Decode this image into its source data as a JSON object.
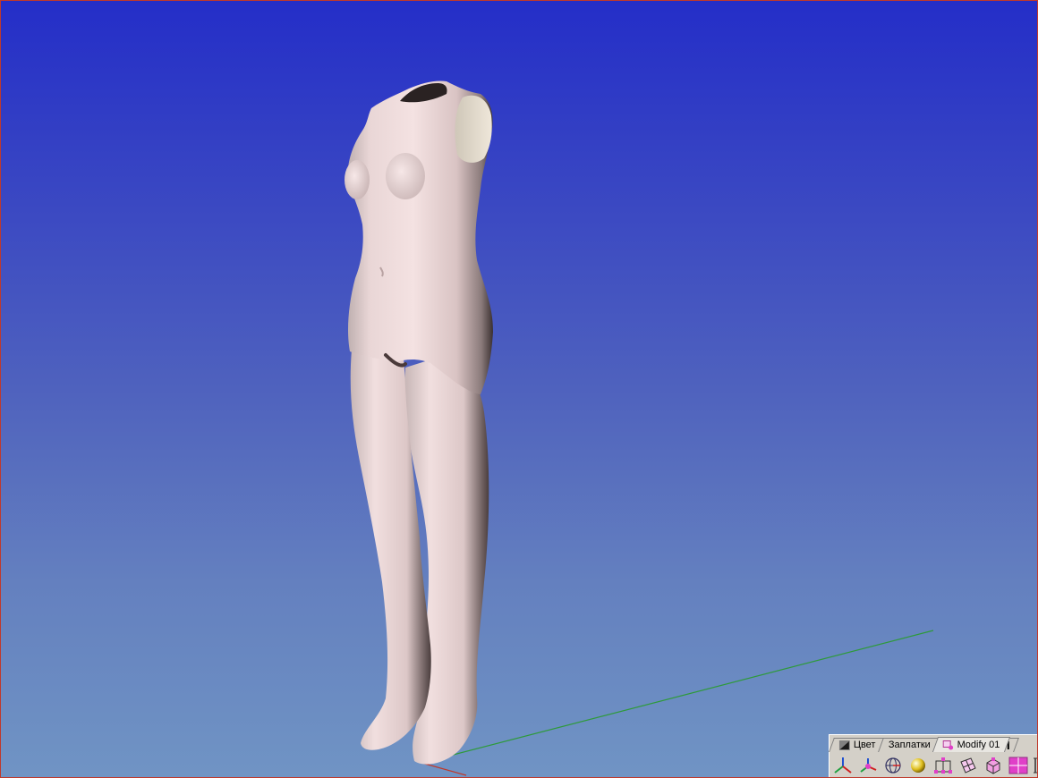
{
  "viewport": {
    "background_top": "#242ec8",
    "background_bottom": "#7094c4",
    "border_color": "#c0392b",
    "model_color": "#f0dcdc",
    "ground_x_axis_color": "#c0392b",
    "ground_y_axis_color": "#2e9a3a"
  },
  "toolbar": {
    "tabs": [
      {
        "label": "Цвет",
        "icon": "color-tab-icon"
      },
      {
        "label": "Заплатки",
        "icon": ""
      },
      {
        "label": "Modify 01",
        "icon": "modify-tab-icon",
        "active": true
      }
    ],
    "tools": [
      {
        "name": "axes-tool-icon"
      },
      {
        "name": "move-axes-tool-icon"
      },
      {
        "name": "sphere-grid-tool-icon"
      },
      {
        "name": "shaded-sphere-tool-icon"
      },
      {
        "name": "control-points-tool-icon"
      },
      {
        "name": "patch-edit-tool-icon"
      },
      {
        "name": "cube-select-tool-icon"
      },
      {
        "name": "grid-select-tool-icon"
      },
      {
        "name": "more-tools-icon"
      }
    ],
    "accent": "#e040c8"
  }
}
